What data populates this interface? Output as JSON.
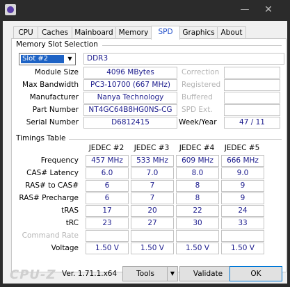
{
  "window": {
    "minimize_glyph": "—",
    "close_glyph": "✕"
  },
  "tabs": [
    "CPU",
    "Caches",
    "Mainboard",
    "Memory",
    "SPD",
    "Graphics",
    "About"
  ],
  "memory_slot": {
    "group_title": "Memory Slot Selection",
    "slot_selected": "Slot #2",
    "type": "DDR3",
    "labels": {
      "module_size": "Module Size",
      "max_bandwidth": "Max Bandwidth",
      "manufacturer": "Manufacturer",
      "part_number": "Part Number",
      "serial_number": "Serial Number",
      "correction": "Correction",
      "registered": "Registered",
      "buffered": "Buffered",
      "spd_ext": "SPD Ext.",
      "week_year": "Week/Year"
    },
    "module_size": "4096 MBytes",
    "max_bandwidth": "PC3-10700 (667 MHz)",
    "manufacturer": "Nanya Technology",
    "part_number": "NT4GC64B8HG0NS-CG",
    "serial_number": "D6812415",
    "week_year": "47 / 11"
  },
  "timings": {
    "group_title": "Timings Table",
    "columns": [
      "JEDEC #2",
      "JEDEC #3",
      "JEDEC #4",
      "JEDEC #5"
    ],
    "rows": [
      {
        "label": "Frequency",
        "values": [
          "457 MHz",
          "533 MHz",
          "609 MHz",
          "666 MHz"
        ]
      },
      {
        "label": "CAS# Latency",
        "values": [
          "6.0",
          "7.0",
          "8.0",
          "9.0"
        ]
      },
      {
        "label": "RAS# to CAS#",
        "values": [
          "6",
          "7",
          "8",
          "9"
        ]
      },
      {
        "label": "RAS# Precharge",
        "values": [
          "6",
          "7",
          "8",
          "9"
        ]
      },
      {
        "label": "tRAS",
        "values": [
          "17",
          "20",
          "22",
          "24"
        ]
      },
      {
        "label": "tRC",
        "values": [
          "23",
          "27",
          "30",
          "33"
        ]
      },
      {
        "label": "Command Rate",
        "values": [
          "",
          "",
          "",
          ""
        ]
      },
      {
        "label": "Voltage",
        "values": [
          "1.50 V",
          "1.50 V",
          "1.50 V",
          "1.50 V"
        ]
      }
    ]
  },
  "footer": {
    "logo": "CPU-Z",
    "version": "Ver. 1.71.1.x64",
    "tools_label": "Tools",
    "validate_label": "Validate",
    "ok_label": "OK"
  },
  "colors": {
    "accent_tab": "#1e4cc9",
    "value_text": "#1a1a8c",
    "slot_highlight": "#1e63c5"
  }
}
